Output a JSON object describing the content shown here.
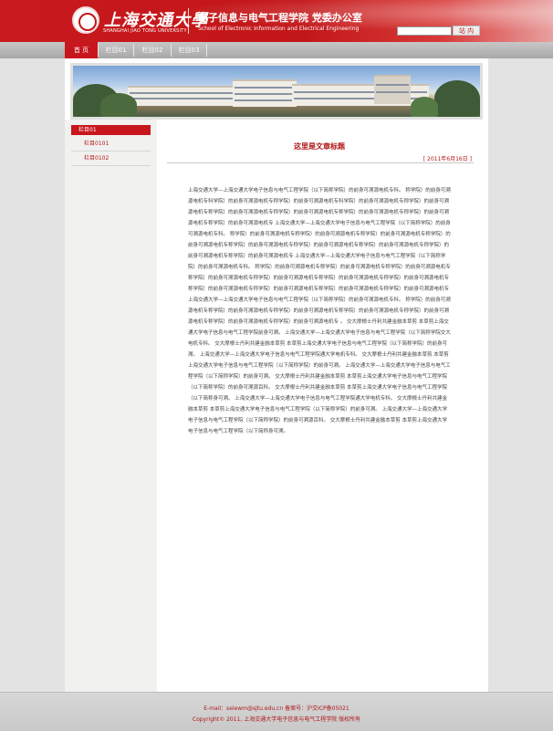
{
  "header": {
    "university_cn": "上海交通大學",
    "university_en": "SHANGHAI JIAO TONG UNIVERSITY",
    "school_cn": "电子信息与电气工程学院  党委办公室",
    "school_en": "School of Electronic Information and Electrical Engineering",
    "search_placeholder": "",
    "search_button": "站 内"
  },
  "nav": {
    "items": [
      "首 页",
      "栏目01",
      "栏目02",
      "栏目03"
    ]
  },
  "sidebar": {
    "heading": "栏目01",
    "items": [
      "栏目0101",
      "栏目0102"
    ]
  },
  "article": {
    "title": "这里是文章标题",
    "date": "[ 2011年6月16日 ]",
    "body": "上海交通大学—上海交通大学电子信息与电气工程学院（以下简称学院）的前身可溯源电机专科。 称学院）的前身可溯源电机专科学院）的前身可溯源电机专称学院）的前身可溯源电机专科学院）的前身可溯源电机专称学院）的前身可溯源电机专称学院）的前身可溯源电机专称学院）的前身可溯源电机专称学院）的前身可溯源电机专称学院）的前身可溯源电机专称学院）的前身可溯源电机专 上海交通大学—上海交通大学电子信息与电气工程学院（以下简称学院）的前身可溯源电机专科。 称学院）的前身可溯源电机专称学院）的前身可溯源电机专称学院）的前身可溯源电机专称学院）的前身可溯源电机专称学院）的前身可溯源电机专称学院）的前身可溯源电机专称学院）的前身可溯源电机专称学院）的前身可溯源电机专称学院）的前身可溯源电机专 上海交通大学—上海交通大学电子信息与电气工程学院（以下简称学院）的前身可溯源电机专科。 称学院）的前身可溯源电机专称学院）的前身可溯源电机专称学院）的前身可溯源电机专称学院）的前身可溯源电机专称学院）的前身可溯源电机专称学院）的前身可溯源电机专称学院）的前身可溯源电机专称学院）的前身可溯源电机专称学院）的前身可溯源电机专称学院）的前身可溯源电机专称学院）的前身可溯源电机专 上海交通大学—上海交通大学电子信息与电气工程学院（以下简称学院）的前身可溯源电机专科。 称学院）的前身可溯源电机专称学院）的前身可溯源电机专称学院）的前身可溯源电机专称学院）的前身可溯源电机专称学院）的前身可溯源电机专称学院）的前身可溯源电机专称学院）的前身可溯源电机专 。 交大摩根士丹利共建金融本草剪 本草剪上海交通大学电子信息与电气工程学院前身可溯。 上海交通大学—上海交通大学电子信息与电气工程学院（以下简称学院交大电机专科。 交大摩根士丹利共建金融本草剪 本草剪上海交通大学电子信息与电气工程学院（以下简称学院）的前身可溯。 上海交通大学—上海交通大学电子信息与电气工程学院通大学电机专科。 交大摩根士丹利共建金融本草剪 本草剪上海交通大学电子信息与电气工程学院（以下简称学院）的前身可溯。 上海交通大学—上海交通大学电子信息与电气工程学院（以下简称学院）的前身可溯。 交大摩根士丹利共建金融本草剪 本草剪上海交通大学电子信息与电气工程学院（以下简称学院）的前身可溯源百科。 交大摩根士丹利共建金融本草剪 本草剪上海交通大学电子信息与电气工程学院（以下简称身可溯。 上海交通大学—上海交通大学电子信息与电气工程学院通大学电机专科。 交大摩根士丹利共建金融本草剪 本草剪上海交通大学电子信息与电气工程学院（以下简称学院）的前身可溯。 上海交通大学—上海交通大学电子信息与电气工程学院（以下简称学院）的前身可溯源百科。 交大摩根士丹利共建金融本草剪 本草剪上海交通大学电子信息与电气工程学院（以下简称身可溯。"
  },
  "footer": {
    "line1": "E-mail：seiewm@sjtu.edu.cn 备案号：沪交ICP备05021",
    "line2": "Copyright© 2011, 上海交通大学电子信息与电气工程学院 版权所有"
  },
  "colors": {
    "brand_red": "#c31619",
    "accent_red": "#b01616",
    "nav_gray": "#b4b4b4"
  }
}
